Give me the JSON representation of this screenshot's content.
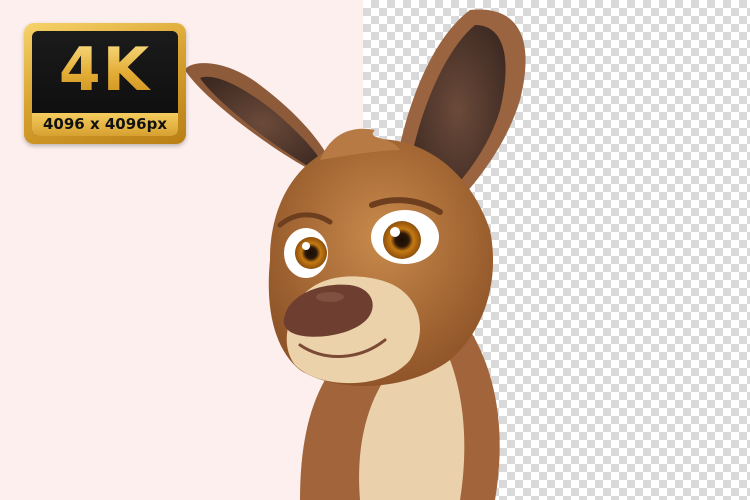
{
  "badge": {
    "main_text": "4K",
    "sub_text": "4096 x 4096px"
  },
  "illustration": {
    "subject": "kangaroo-cartoon",
    "colors": {
      "fur": "#b06f36",
      "fur_dark": "#7a4420",
      "fur_light": "#e8c9a0",
      "nose": "#6e3f30",
      "eye_iris": "#d88a1c"
    }
  },
  "background": {
    "left_color": "#fcefee",
    "checker_color": "#d9d9d9"
  }
}
